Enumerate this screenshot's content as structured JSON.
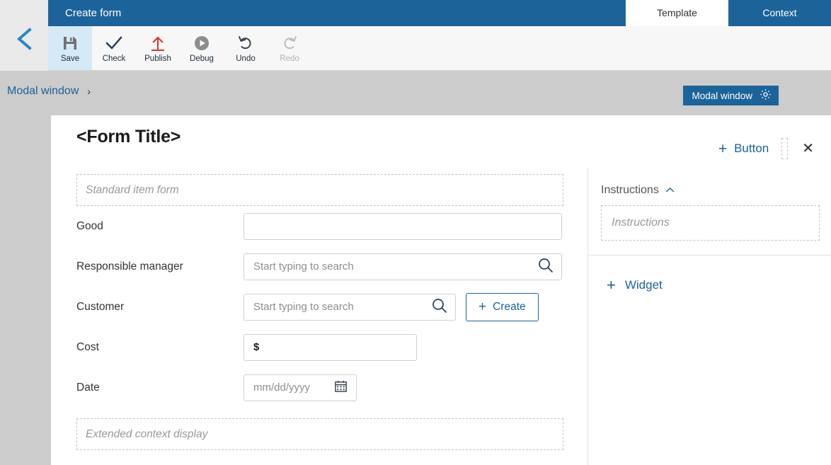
{
  "colors": {
    "header_blue": "#1c6399",
    "page_gray": "#cccccc",
    "toolbar_bg": "#f7f7f7",
    "active_tool_bg": "#d5e9f6",
    "publish_red": "#e03030",
    "link_blue": "#1c6399"
  },
  "header": {
    "back_icon": "chevron-left-icon",
    "title": "Create form",
    "tabs": [
      {
        "label": "Template",
        "active": true
      },
      {
        "label": "Context",
        "active": false
      }
    ]
  },
  "toolbar": {
    "buttons": [
      {
        "label": "Save",
        "icon": "floppy-disk-icon",
        "active": true,
        "disabled": false
      },
      {
        "label": "Check",
        "icon": "checkmark-icon",
        "active": false,
        "disabled": false
      },
      {
        "label": "Publish",
        "icon": "upload-arrow-icon",
        "active": false,
        "disabled": false
      },
      {
        "label": "Debug",
        "icon": "play-circle-icon",
        "active": false,
        "disabled": false
      },
      {
        "label": "Undo",
        "icon": "undo-arrow-icon",
        "active": false,
        "disabled": false
      },
      {
        "label": "Redo",
        "icon": "redo-arrow-icon",
        "active": false,
        "disabled": true
      }
    ]
  },
  "breadcrumb": {
    "label": "Modal window",
    "separator": "›"
  },
  "modal_badge": {
    "label": "Modal window",
    "icon": "gear-icon"
  },
  "card": {
    "title": "<Form Title>",
    "add_button_label": "Button",
    "add_button_plus": "+",
    "button_slot_placeholder": "empty-button-slot",
    "close_icon": "close-icon"
  },
  "form": {
    "top_dropzone": "Standard item form",
    "bottom_dropzone": "Extended context display",
    "rows": [
      {
        "label": "Good",
        "control": "text",
        "value": "",
        "placeholder": ""
      },
      {
        "label": "Responsible manager",
        "control": "search",
        "value": "",
        "placeholder": "Start typing to search",
        "icon": "search-icon"
      },
      {
        "label": "Customer",
        "control": "search-with-button",
        "value": "",
        "placeholder": "Start typing to search",
        "icon": "search-icon",
        "button_label": "Create",
        "button_plus": "+"
      },
      {
        "label": "Cost",
        "control": "currency",
        "value": "$",
        "placeholder": ""
      },
      {
        "label": "Date",
        "control": "date",
        "value": "",
        "placeholder": "mm/dd/yyyy",
        "icon": "calendar-icon"
      }
    ]
  },
  "right_panel": {
    "section_title": "Instructions",
    "collapse_icon": "chevron-up-icon",
    "dropzone_placeholder": "Instructions",
    "add_widget_label": "Widget",
    "add_widget_plus": "+"
  }
}
